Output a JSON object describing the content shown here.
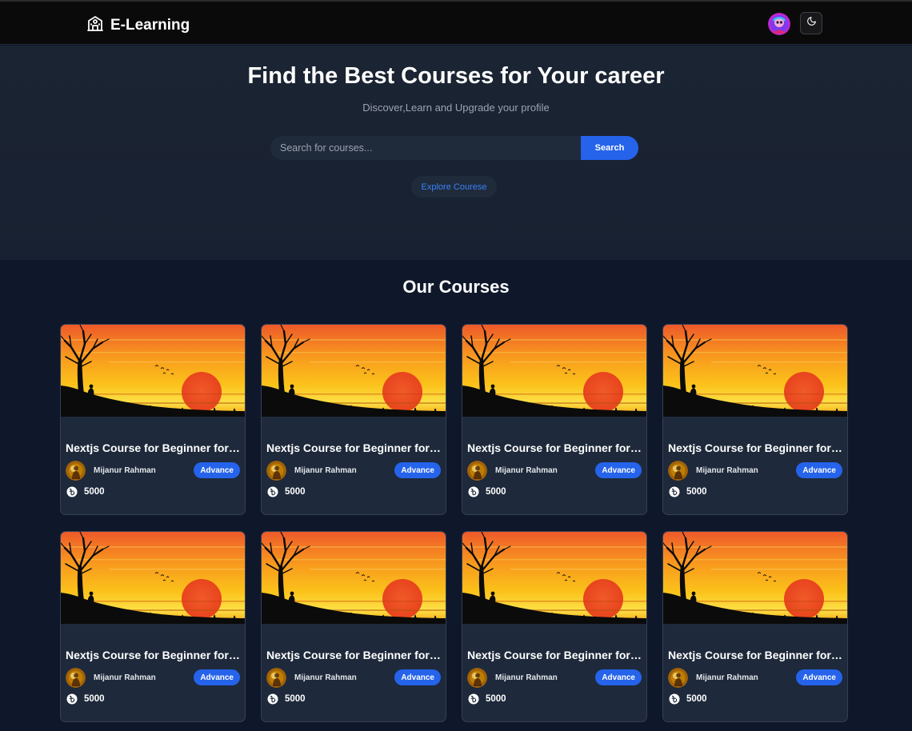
{
  "navbar": {
    "brand": "E-Learning",
    "icons": {
      "logo": "school-icon",
      "avatar": "user-avatar",
      "theme": "moon-icon"
    }
  },
  "hero": {
    "title": "Find the Best Courses for Your career",
    "subtitle": "Discover,Learn and Upgrade your profile",
    "search_placeholder": "Search for courses...",
    "search_button": "Search",
    "explore_button": "Explore Courese"
  },
  "courses_section": {
    "title": "Our Courses",
    "courses": [
      {
        "title": "Nextjs Course for Beginner for the full course",
        "author": "Mijanur Rahman",
        "level": "Advance",
        "price": "5000"
      },
      {
        "title": "Nextjs Course for Beginner for the full course",
        "author": "Mijanur Rahman",
        "level": "Advance",
        "price": "5000"
      },
      {
        "title": "Nextjs Course for Beginner for the full course",
        "author": "Mijanur Rahman",
        "level": "Advance",
        "price": "5000"
      },
      {
        "title": "Nextjs Course for Beginner for the full course",
        "author": "Mijanur Rahman",
        "level": "Advance",
        "price": "5000"
      },
      {
        "title": "Nextjs Course for Beginner for the full course",
        "author": "Mijanur Rahman",
        "level": "Advance",
        "price": "5000"
      },
      {
        "title": "Nextjs Course for Beginner for the full course",
        "author": "Mijanur Rahman",
        "level": "Advance",
        "price": "5000"
      },
      {
        "title": "Nextjs Course for Beginner for the full course",
        "author": "Mijanur Rahman",
        "level": "Advance",
        "price": "5000"
      },
      {
        "title": "Nextjs Course for Beginner for the full course",
        "author": "Mijanur Rahman",
        "level": "Advance",
        "price": "5000"
      }
    ]
  },
  "colors": {
    "accent": "#2563eb",
    "page_bg": "#0f172a",
    "card_bg": "#1e293b",
    "nav_bg": "#0a0a0a"
  }
}
